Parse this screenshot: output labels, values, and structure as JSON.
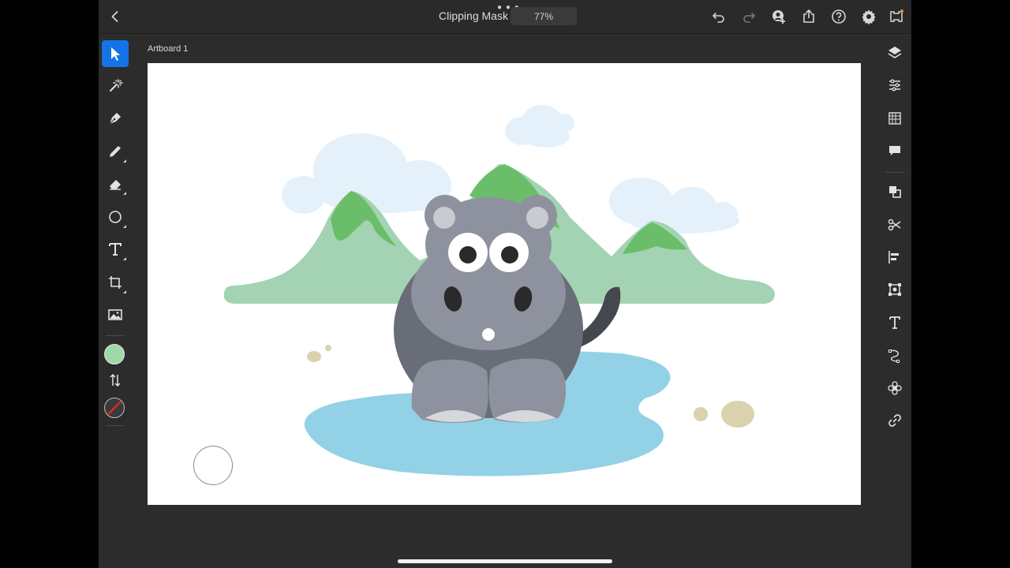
{
  "header": {
    "title": "Clipping Mask",
    "zoom": "77%",
    "icons": [
      "chevron-left-icon",
      "undo-icon",
      "redo-icon",
      "invite-icon",
      "share-icon",
      "help-icon",
      "gear-icon",
      "learn-icon"
    ]
  },
  "canvas": {
    "artboard_label": "Artboard 1"
  },
  "left_toolbar": {
    "tools": [
      "select-tool",
      "magic-select-tool",
      "pen-tool",
      "pencil-tool",
      "eraser-tool",
      "shape-tool",
      "text-tool",
      "crop-tool",
      "image-tool"
    ],
    "fill_color": "#9fd9a8",
    "stroke": "none"
  },
  "right_toolbar": {
    "panels": [
      "layers-panel",
      "properties-panel",
      "libraries-panel",
      "comments-panel",
      "pathfinder-panel",
      "scissors-tool",
      "align-panel",
      "transform-panel",
      "type-panel",
      "path-panel",
      "effects-panel",
      "links-panel"
    ]
  },
  "colors": {
    "accent": "#1473e6",
    "mountain_light": "#a3d3b3",
    "mountain_dark": "#6abe69",
    "water": "#92d1e6",
    "cloud": "#e5f1fa",
    "body": "#686d78",
    "face": "#8d929e",
    "pebble": "#d9d2ad"
  }
}
